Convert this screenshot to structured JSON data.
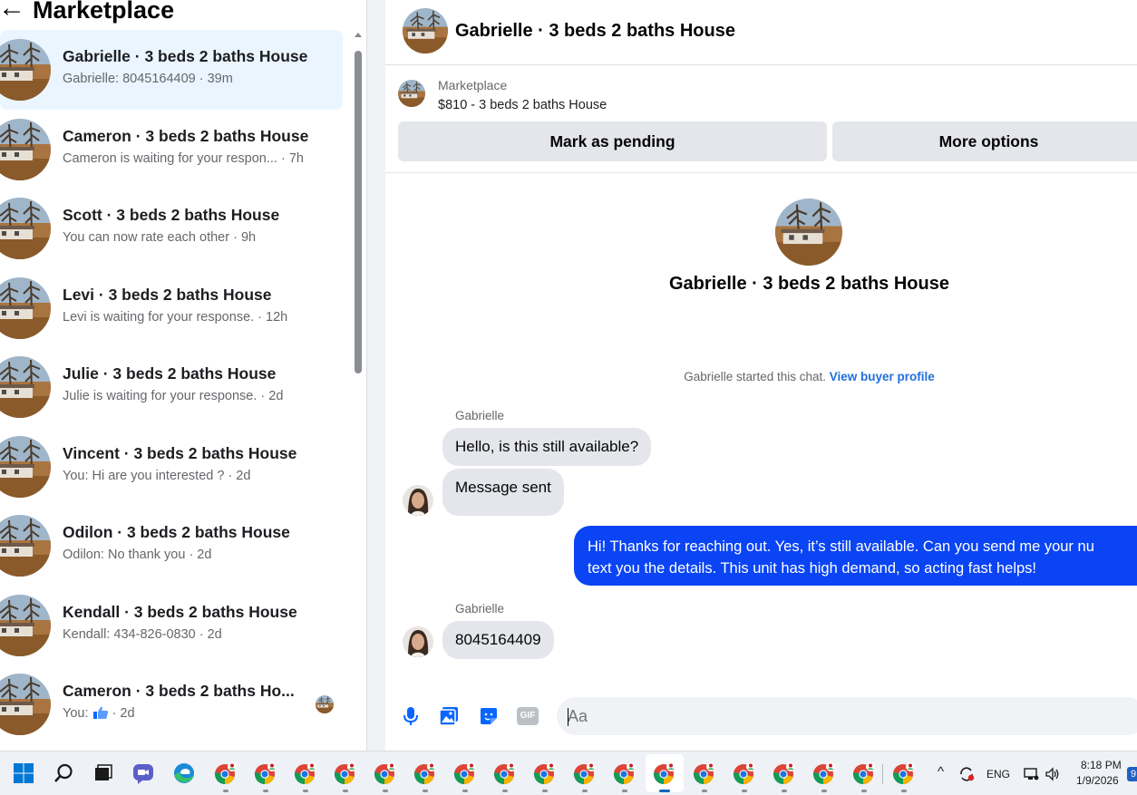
{
  "sidebar": {
    "title": "Marketplace",
    "conversations": [
      {
        "title": "Gabrielle · 3 beds 2 baths House",
        "subtitle": "Gabrielle: 8045164409 · 39m",
        "active": true
      },
      {
        "title": "Cameron · 3 beds 2 baths House",
        "subtitle": "Cameron is waiting for your respon... · 7h"
      },
      {
        "title": "Scott · 3 beds 2 baths House",
        "subtitle": "You can now rate each other · 9h"
      },
      {
        "title": "Levi · 3 beds 2 baths House",
        "subtitle": "Levi is waiting for your response. · 12h"
      },
      {
        "title": "Julie · 3 beds 2 baths House",
        "subtitle": "Julie is waiting for your response. · 2d"
      },
      {
        "title": "Vincent · 3 beds 2 baths House",
        "subtitle": "You: Hi are you interested ? · 2d"
      },
      {
        "title": "Odilon · 3 beds 2 baths House",
        "subtitle": "Odilon: No thank you · 2d"
      },
      {
        "title": "Kendall · 3 beds 2 baths House",
        "subtitle": "Kendall: 434-826-0830 · 2d"
      },
      {
        "title": "Cameron · 3 beds 2 baths Ho...",
        "subtitle_prefix": "You:",
        "subtitle_suffix": " · 2d",
        "subtitle_icon": "thumbs-up-icon"
      }
    ]
  },
  "chat": {
    "header_title": "Gabrielle · 3 beds 2 baths House",
    "listing": {
      "label": "Marketplace",
      "price_title": "$810 - 3 beds 2 baths House",
      "pending_button": "Mark as pending",
      "more_button": "More options"
    },
    "intro": {
      "title": "Gabrielle · 3 beds 2 baths House",
      "started_text": "Gabrielle started this chat. ",
      "profile_link": "View buyer profile"
    },
    "messages": {
      "sender_1": "Gabrielle",
      "in_1": "Hello, is this still available?",
      "in_2": "Message sent",
      "out_line1": "Hi! Thanks for reaching out. Yes, it’s still available. Can you send me your nu",
      "out_line2": "text you the details. This unit has high demand, so acting fast helps!",
      "sender_2": "Gabrielle",
      "in_3": "8045164409"
    },
    "composer": {
      "placeholder": "Aa",
      "icons": [
        "microphone-icon",
        "photo-icon",
        "sticker-icon",
        "gif-icon"
      ],
      "gif_label": "GIF"
    }
  },
  "taskbar": {
    "language": "ENG",
    "time": "8:18 PM",
    "date": "1/9/2026",
    "notification_count": "9",
    "accent": "#0067c0"
  },
  "colors": {
    "outgoing_bubble": "#0a44f4",
    "link": "#216fdb",
    "active_conversation": "#ebf5ff"
  }
}
